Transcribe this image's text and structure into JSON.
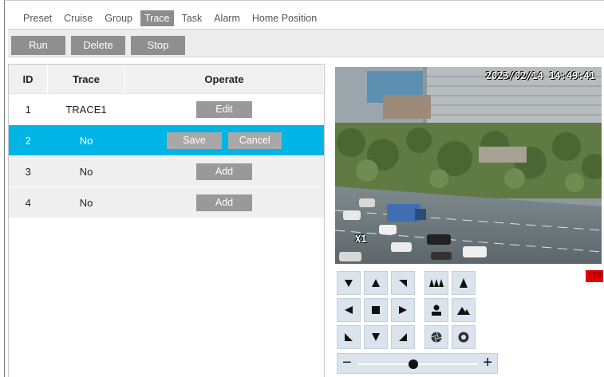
{
  "tabs": [
    "Preset",
    "Cruise",
    "Group",
    "Trace",
    "Task",
    "Alarm",
    "Home Position"
  ],
  "active_tab": "Trace",
  "toolbar": {
    "run_label": "Run",
    "delete_label": "Delete",
    "stop_label": "Stop"
  },
  "table": {
    "headers": {
      "id": "ID",
      "trace": "Trace",
      "operate": "Operate"
    },
    "rows": [
      {
        "id": "1",
        "trace": "TRACE1",
        "actions": [
          "Edit"
        ]
      },
      {
        "id": "2",
        "trace": "No",
        "actions": [
          "Save",
          "Cancel"
        ]
      },
      {
        "id": "3",
        "trace": "No",
        "actions": [
          "Add"
        ]
      },
      {
        "id": "4",
        "trace": "No",
        "actions": [
          "Add"
        ]
      }
    ],
    "selected_row_id": "2"
  },
  "video": {
    "timestamp": "2023/02/14 14:49:41",
    "zoom_label": "X1"
  },
  "status_badge": "178",
  "ptz": {
    "direction_icons": [
      "pan-down-left-icon",
      "pan-up-icon",
      "pan-up-right-icon",
      "pan-left-icon",
      "stop-icon",
      "pan-right-icon",
      "pan-down-left-2-icon",
      "pan-down-icon",
      "pan-down-right-icon"
    ],
    "lens_icons": [
      "zoom-out-icon",
      "zoom-in-icon",
      "focus-near-icon",
      "focus-far-icon",
      "iris-close-icon",
      "iris-open-icon"
    ],
    "zoom_slider_level": 0.46
  },
  "colors": {
    "selected_row": "#00b4e6",
    "button_gray": "#999999",
    "badge": "#e00000",
    "ptz_button": "#dbe3ec"
  }
}
